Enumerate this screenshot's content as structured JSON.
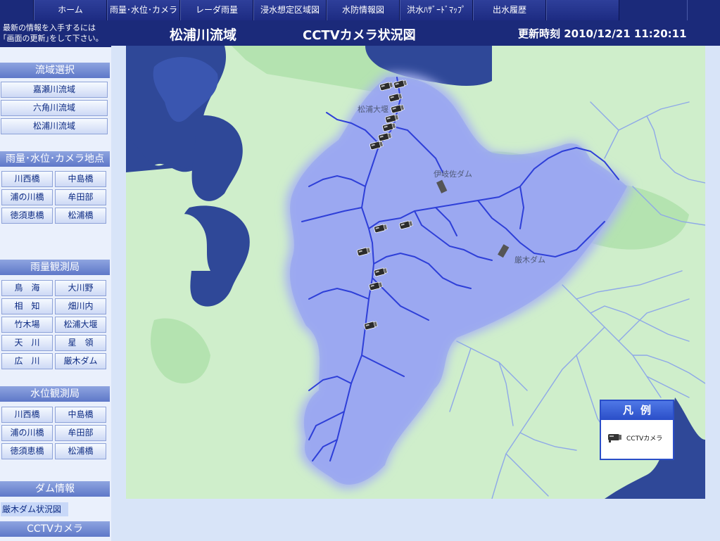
{
  "nav": {
    "items": [
      "ホーム",
      "雨量･水位･カメラ",
      "レーダ雨量",
      "浸水想定区域図",
      "水防情報図",
      "洪水ﾊｻﾞｰﾄﾞﾏｯﾌﾟ",
      "出水履歴",
      ""
    ]
  },
  "notice": {
    "line1": "最新の情報を入手するには",
    "line2": "｢画面の更新｣をして下さい。"
  },
  "header": {
    "basin": "松浦川流域",
    "title": "CCTVカメラ状況図",
    "update": "更新時刻 2010/12/21 11:20:11"
  },
  "sidebar": {
    "basin_select": {
      "title": "流域選択",
      "items": [
        "嘉瀬川流域",
        "六角川流域",
        "松浦川流域"
      ]
    },
    "points": {
      "title": "雨量･水位･カメラ地点",
      "items": [
        "川西橋",
        "中島橋",
        "浦の川橋",
        "牟田部",
        "徳須恵橋",
        "松浦橋"
      ]
    },
    "rain": {
      "title": "雨量観測局",
      "items": [
        "鳥　海",
        "大川野",
        "相　知",
        "畑川内",
        "竹木場",
        "松浦大堰",
        "天　川",
        "星　領",
        "広　川",
        "厳木ダム"
      ]
    },
    "water": {
      "title": "水位観測局",
      "items": [
        "川西橋",
        "中島橋",
        "浦の川橋",
        "牟田部",
        "徳須恵橋",
        "松浦橋"
      ]
    },
    "dam": {
      "title": "ダム情報",
      "link": "厳木ダム状況図"
    },
    "cctv": {
      "title": "CCTVカメラ"
    }
  },
  "map": {
    "labels": {
      "weir": "松浦大堰",
      "ikisa_dam": "伊岐佐ダム",
      "kyuragi_dam": "厳木ダム"
    },
    "camera_count": 14,
    "colors": {
      "land": "#cfeecb",
      "sea": "#2f4898",
      "basin": "#9aa8f0",
      "river": "#2e3fd8"
    }
  },
  "legend": {
    "title": "凡例",
    "camera_label": "CCTVカメラ"
  }
}
